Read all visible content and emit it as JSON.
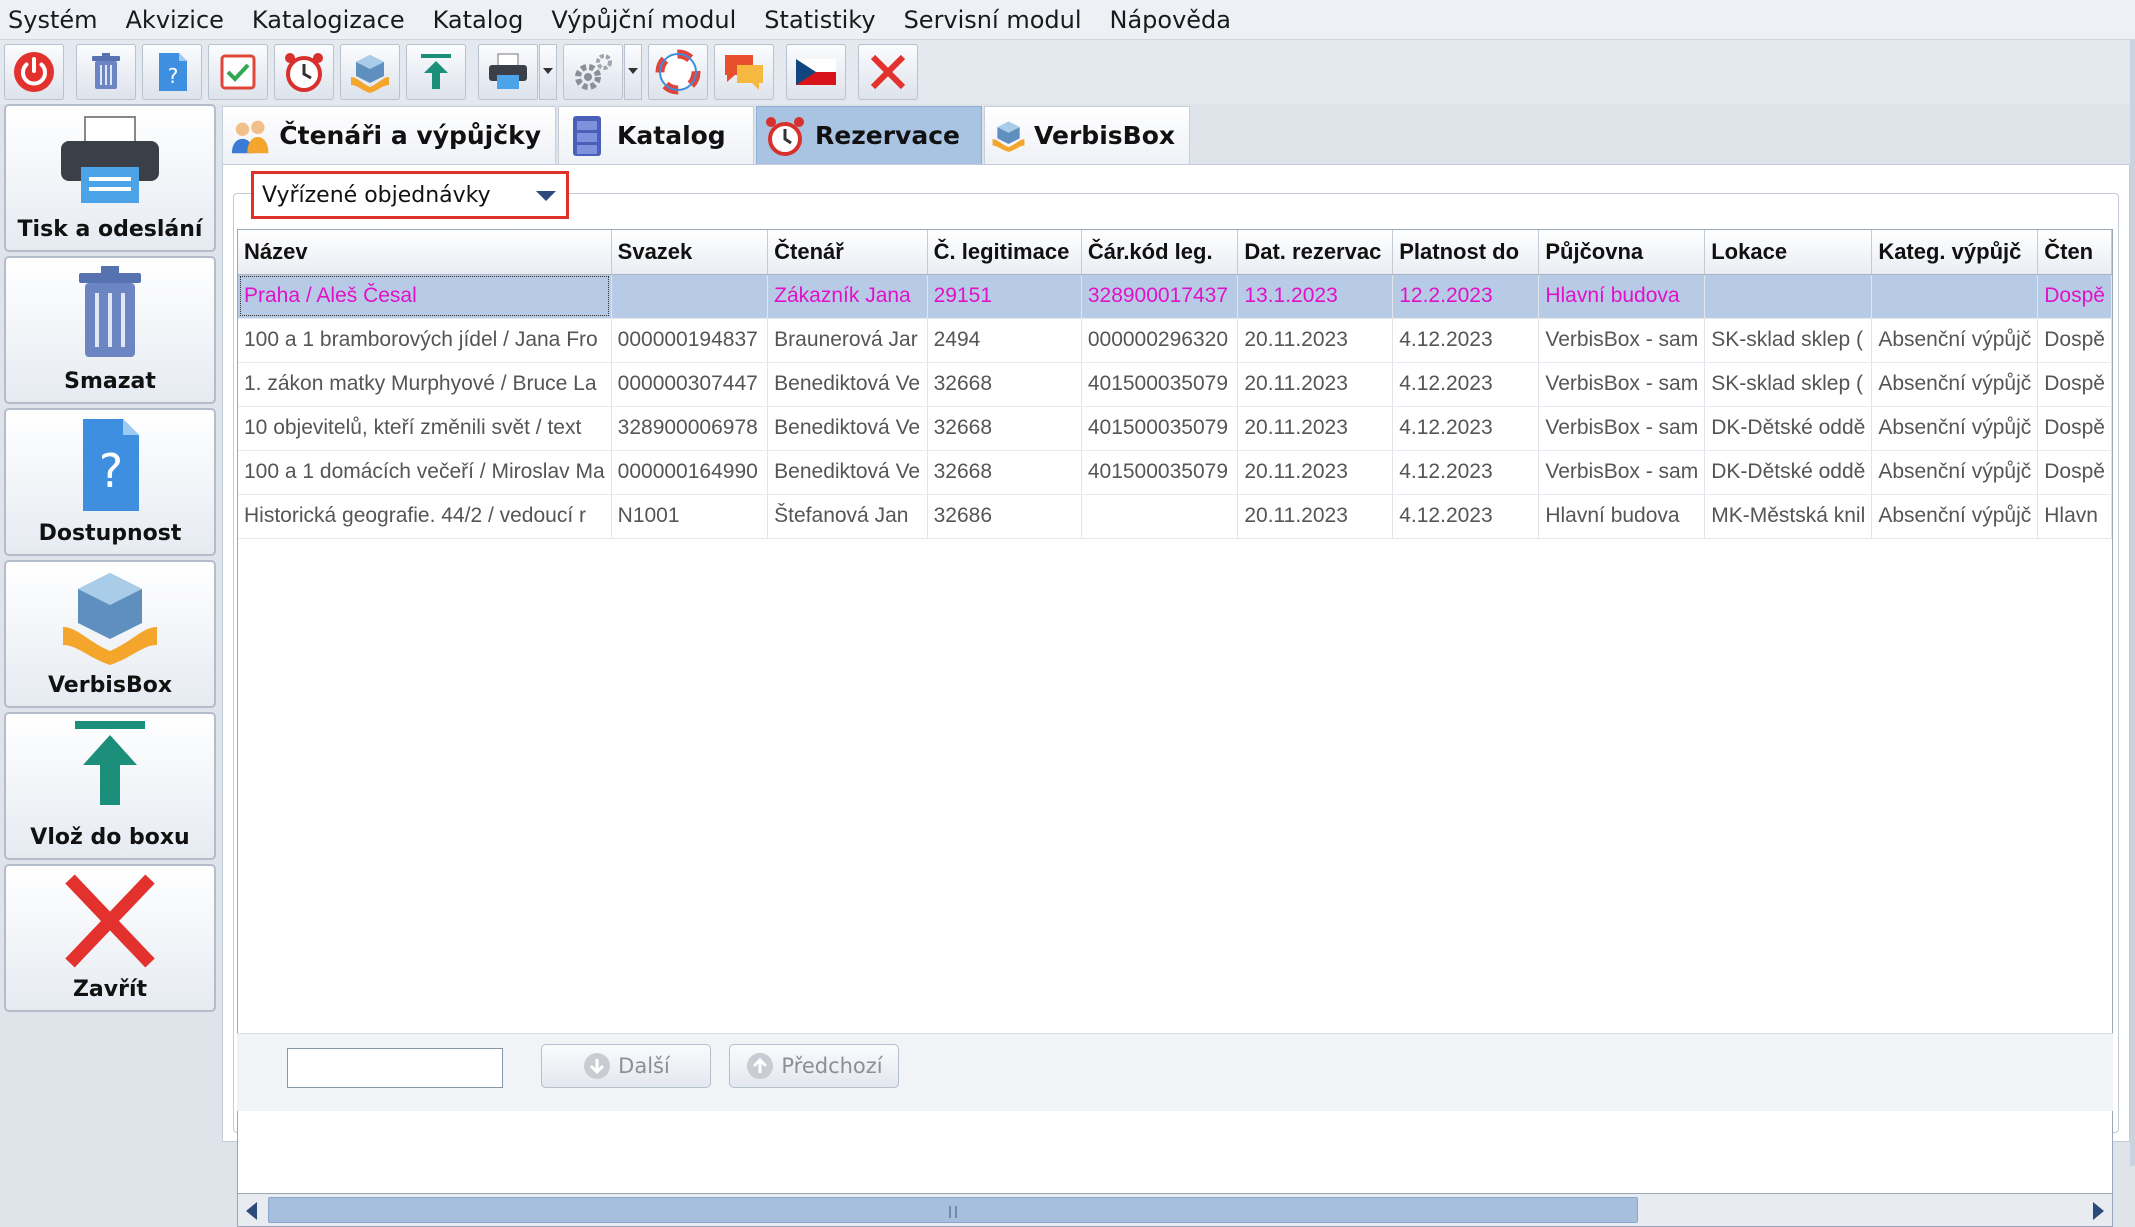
{
  "menu": [
    "Systém",
    "Akvizice",
    "Katalogizace",
    "Katalog",
    "Výpůjční modul",
    "Statistiky",
    "Servisní modul",
    "Nápověda"
  ],
  "toolbar": [
    "power-icon",
    "trash-icon",
    "help-document-icon",
    "checkbox-icon",
    "alarm-clock-icon",
    "verbisbox-icon",
    "upload-icon",
    "printer-icon",
    "settings-icon",
    "lifebuoy-icon",
    "chat-icon",
    "czech-flag-icon",
    "close-icon"
  ],
  "sidebar": {
    "print": "Tisk a odeslání",
    "delete": "Smazat",
    "availability": "Dostupnost",
    "verbisbox": "VerbisBox",
    "insert": "Vlož do boxu",
    "close": "Zavřít"
  },
  "tabs": {
    "readers": "Čtenáři a výpůjčky",
    "catalog": "Katalog",
    "reservations": "Rezervace",
    "verbisbox": "VerbisBox",
    "active": "Rezervace"
  },
  "filter": {
    "selected": "Vyřízené objednávky"
  },
  "grid": {
    "columns": [
      "Název",
      "Svazek",
      "Čtenář",
      "Č. legitimace",
      "Čár.kód leg.",
      "Dat. rezervac",
      "Platnost do",
      "Půjčovna",
      "Lokace",
      "Kateg. výpůjč",
      "Čten"
    ],
    "rows": [
      [
        "Praha / Aleš Česal",
        "",
        "Zákazník Jana",
        "29151",
        "328900017437",
        "13.1.2023",
        "12.2.2023",
        "Hlavní budova",
        "",
        "",
        "Dospě"
      ],
      [
        "100 a 1 bramborových jídel / Jana Fro",
        "000000194837",
        "Braunerová Jar",
        "2494",
        "000000296320",
        "20.11.2023",
        "4.12.2023",
        "VerbisBox - sam",
        "SK-sklad sklep (",
        "Absenční výpůjč",
        "Dospě"
      ],
      [
        "1. zákon matky Murphyové / Bruce La",
        "000000307447",
        "Benediktová Ve",
        "32668",
        "401500035079",
        "20.11.2023",
        "4.12.2023",
        "VerbisBox - sam",
        "SK-sklad sklep (",
        "Absenční výpůjč",
        "Dospě"
      ],
      [
        "10 objevitelů, kteří změnili svět / text",
        "328900006978",
        "Benediktová Ve",
        "32668",
        "401500035079",
        "20.11.2023",
        "4.12.2023",
        "VerbisBox - sam",
        "DK-Dětské oddě",
        "Absenční výpůjč",
        "Dospě"
      ],
      [
        "100 a 1 domácích večeří / Miroslav Ma",
        "000000164990",
        "Benediktová Ve",
        "32668",
        "401500035079",
        "20.11.2023",
        "4.12.2023",
        "VerbisBox - sam",
        "DK-Dětské oddě",
        "Absenční výpůjč",
        "Dospě"
      ],
      [
        "Historická geografie. 44/2 / vedoucí r",
        "N1001",
        "Štefanová  Jan",
        "32686",
        "",
        "20.11.2023",
        "4.12.2023",
        "Hlavní budova",
        "MK-Městská knil",
        "Absenční výpůjč",
        "Hlavn"
      ]
    ],
    "selected_row": 0
  },
  "bottom": {
    "search_value": "",
    "next_label": "Další",
    "prev_label": "Předchozí"
  },
  "colors": {
    "selected_row_bg": "#b8cbe6",
    "selected_row_text": "#e012c8",
    "active_tab": "#a9c4e2",
    "filter_highlight": "#e0302a"
  }
}
